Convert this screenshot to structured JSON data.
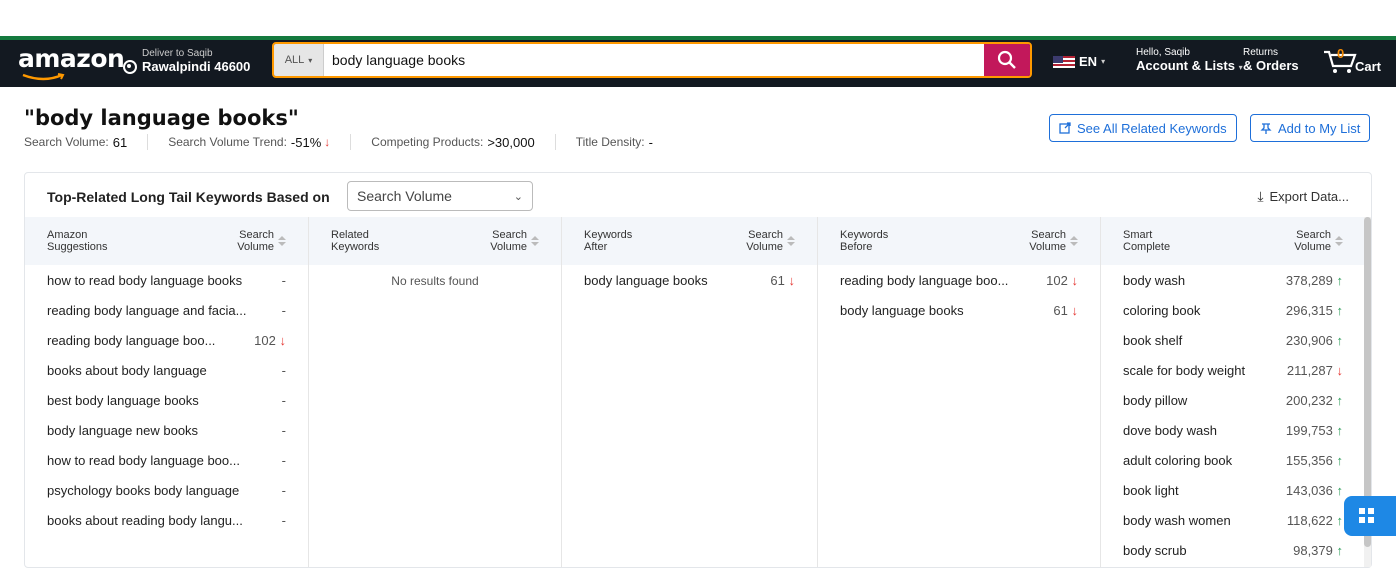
{
  "header": {
    "logo": "amazon",
    "deliver_line1": "Deliver to Saqib",
    "deliver_line2": "Rawalpindi 46600",
    "search_category": "ALL",
    "search_value": "body language books",
    "lang": "EN",
    "account_line1": "Hello, Saqib",
    "account_line2": "Account & Lists",
    "returns_line1": "Returns",
    "returns_line2": "& Orders",
    "cart_count": "0",
    "cart_label": "Cart"
  },
  "keyword": {
    "title": "\"body language books\"",
    "search_volume_label": "Search Volume:",
    "search_volume": "61",
    "trend_label": "Search Volume Trend:",
    "trend_value": "-51%",
    "competing_label": "Competing Products:",
    "competing_value": ">30,000",
    "density_label": "Title Density:",
    "density_value": "-",
    "see_all_btn": "See All Related Keywords",
    "add_list_btn": "Add to My List"
  },
  "card": {
    "title": "Top-Related Long Tail Keywords Based on",
    "select_value": "Search Volume",
    "export": "Export Data..."
  },
  "columns": [
    {
      "head1": "Amazon",
      "head2": "Suggestions",
      "vol1": "Search",
      "vol2": "Volume",
      "rows": [
        {
          "kw": "how to read body language books",
          "vol": "-",
          "dir": ""
        },
        {
          "kw": "reading body language and facia...",
          "vol": "-",
          "dir": ""
        },
        {
          "kw": "reading body language boo...",
          "vol": "102",
          "dir": "down"
        },
        {
          "kw": "books about body language",
          "vol": "-",
          "dir": ""
        },
        {
          "kw": "best body language books",
          "vol": "-",
          "dir": ""
        },
        {
          "kw": "body language new books",
          "vol": "-",
          "dir": ""
        },
        {
          "kw": "how to read body language boo...",
          "vol": "-",
          "dir": ""
        },
        {
          "kw": "psychology books body language",
          "vol": "-",
          "dir": ""
        },
        {
          "kw": "books about reading body langu...",
          "vol": "-",
          "dir": ""
        }
      ]
    },
    {
      "head1": "Related",
      "head2": "Keywords",
      "vol1": "Search",
      "vol2": "Volume",
      "empty": "No results found",
      "rows": []
    },
    {
      "head1": "Keywords",
      "head2": "After",
      "vol1": "Search",
      "vol2": "Volume",
      "rows": [
        {
          "kw": "body language books",
          "vol": "61",
          "dir": "down"
        }
      ]
    },
    {
      "head1": "Keywords",
      "head2": "Before",
      "vol1": "Search",
      "vol2": "Volume",
      "rows": [
        {
          "kw": "reading body language boo...",
          "vol": "102",
          "dir": "down"
        },
        {
          "kw": "body language books",
          "vol": "61",
          "dir": "down"
        }
      ]
    },
    {
      "head1": "Smart",
      "head2": "Complete",
      "vol1": "Search",
      "vol2": "Volume",
      "rows": [
        {
          "kw": "body wash",
          "vol": "378,289",
          "dir": "up"
        },
        {
          "kw": "coloring book",
          "vol": "296,315",
          "dir": "up"
        },
        {
          "kw": "book shelf",
          "vol": "230,906",
          "dir": "up"
        },
        {
          "kw": "scale for body weight",
          "vol": "211,287",
          "dir": "down"
        },
        {
          "kw": "body pillow",
          "vol": "200,232",
          "dir": "up"
        },
        {
          "kw": "dove body wash",
          "vol": "199,753",
          "dir": "up"
        },
        {
          "kw": "adult coloring book",
          "vol": "155,356",
          "dir": "up"
        },
        {
          "kw": "book light",
          "vol": "143,036",
          "dir": "up"
        },
        {
          "kw": "body wash women",
          "vol": "118,622",
          "dir": "up"
        },
        {
          "kw": "body scrub",
          "vol": "98,379",
          "dir": "up"
        }
      ]
    }
  ],
  "colors": {
    "amazon_dark": "#131921",
    "accent_blue": "#1e6fd9",
    "red": "#e53935",
    "green": "#2e9e5b",
    "search_btn": "#c2185b"
  }
}
